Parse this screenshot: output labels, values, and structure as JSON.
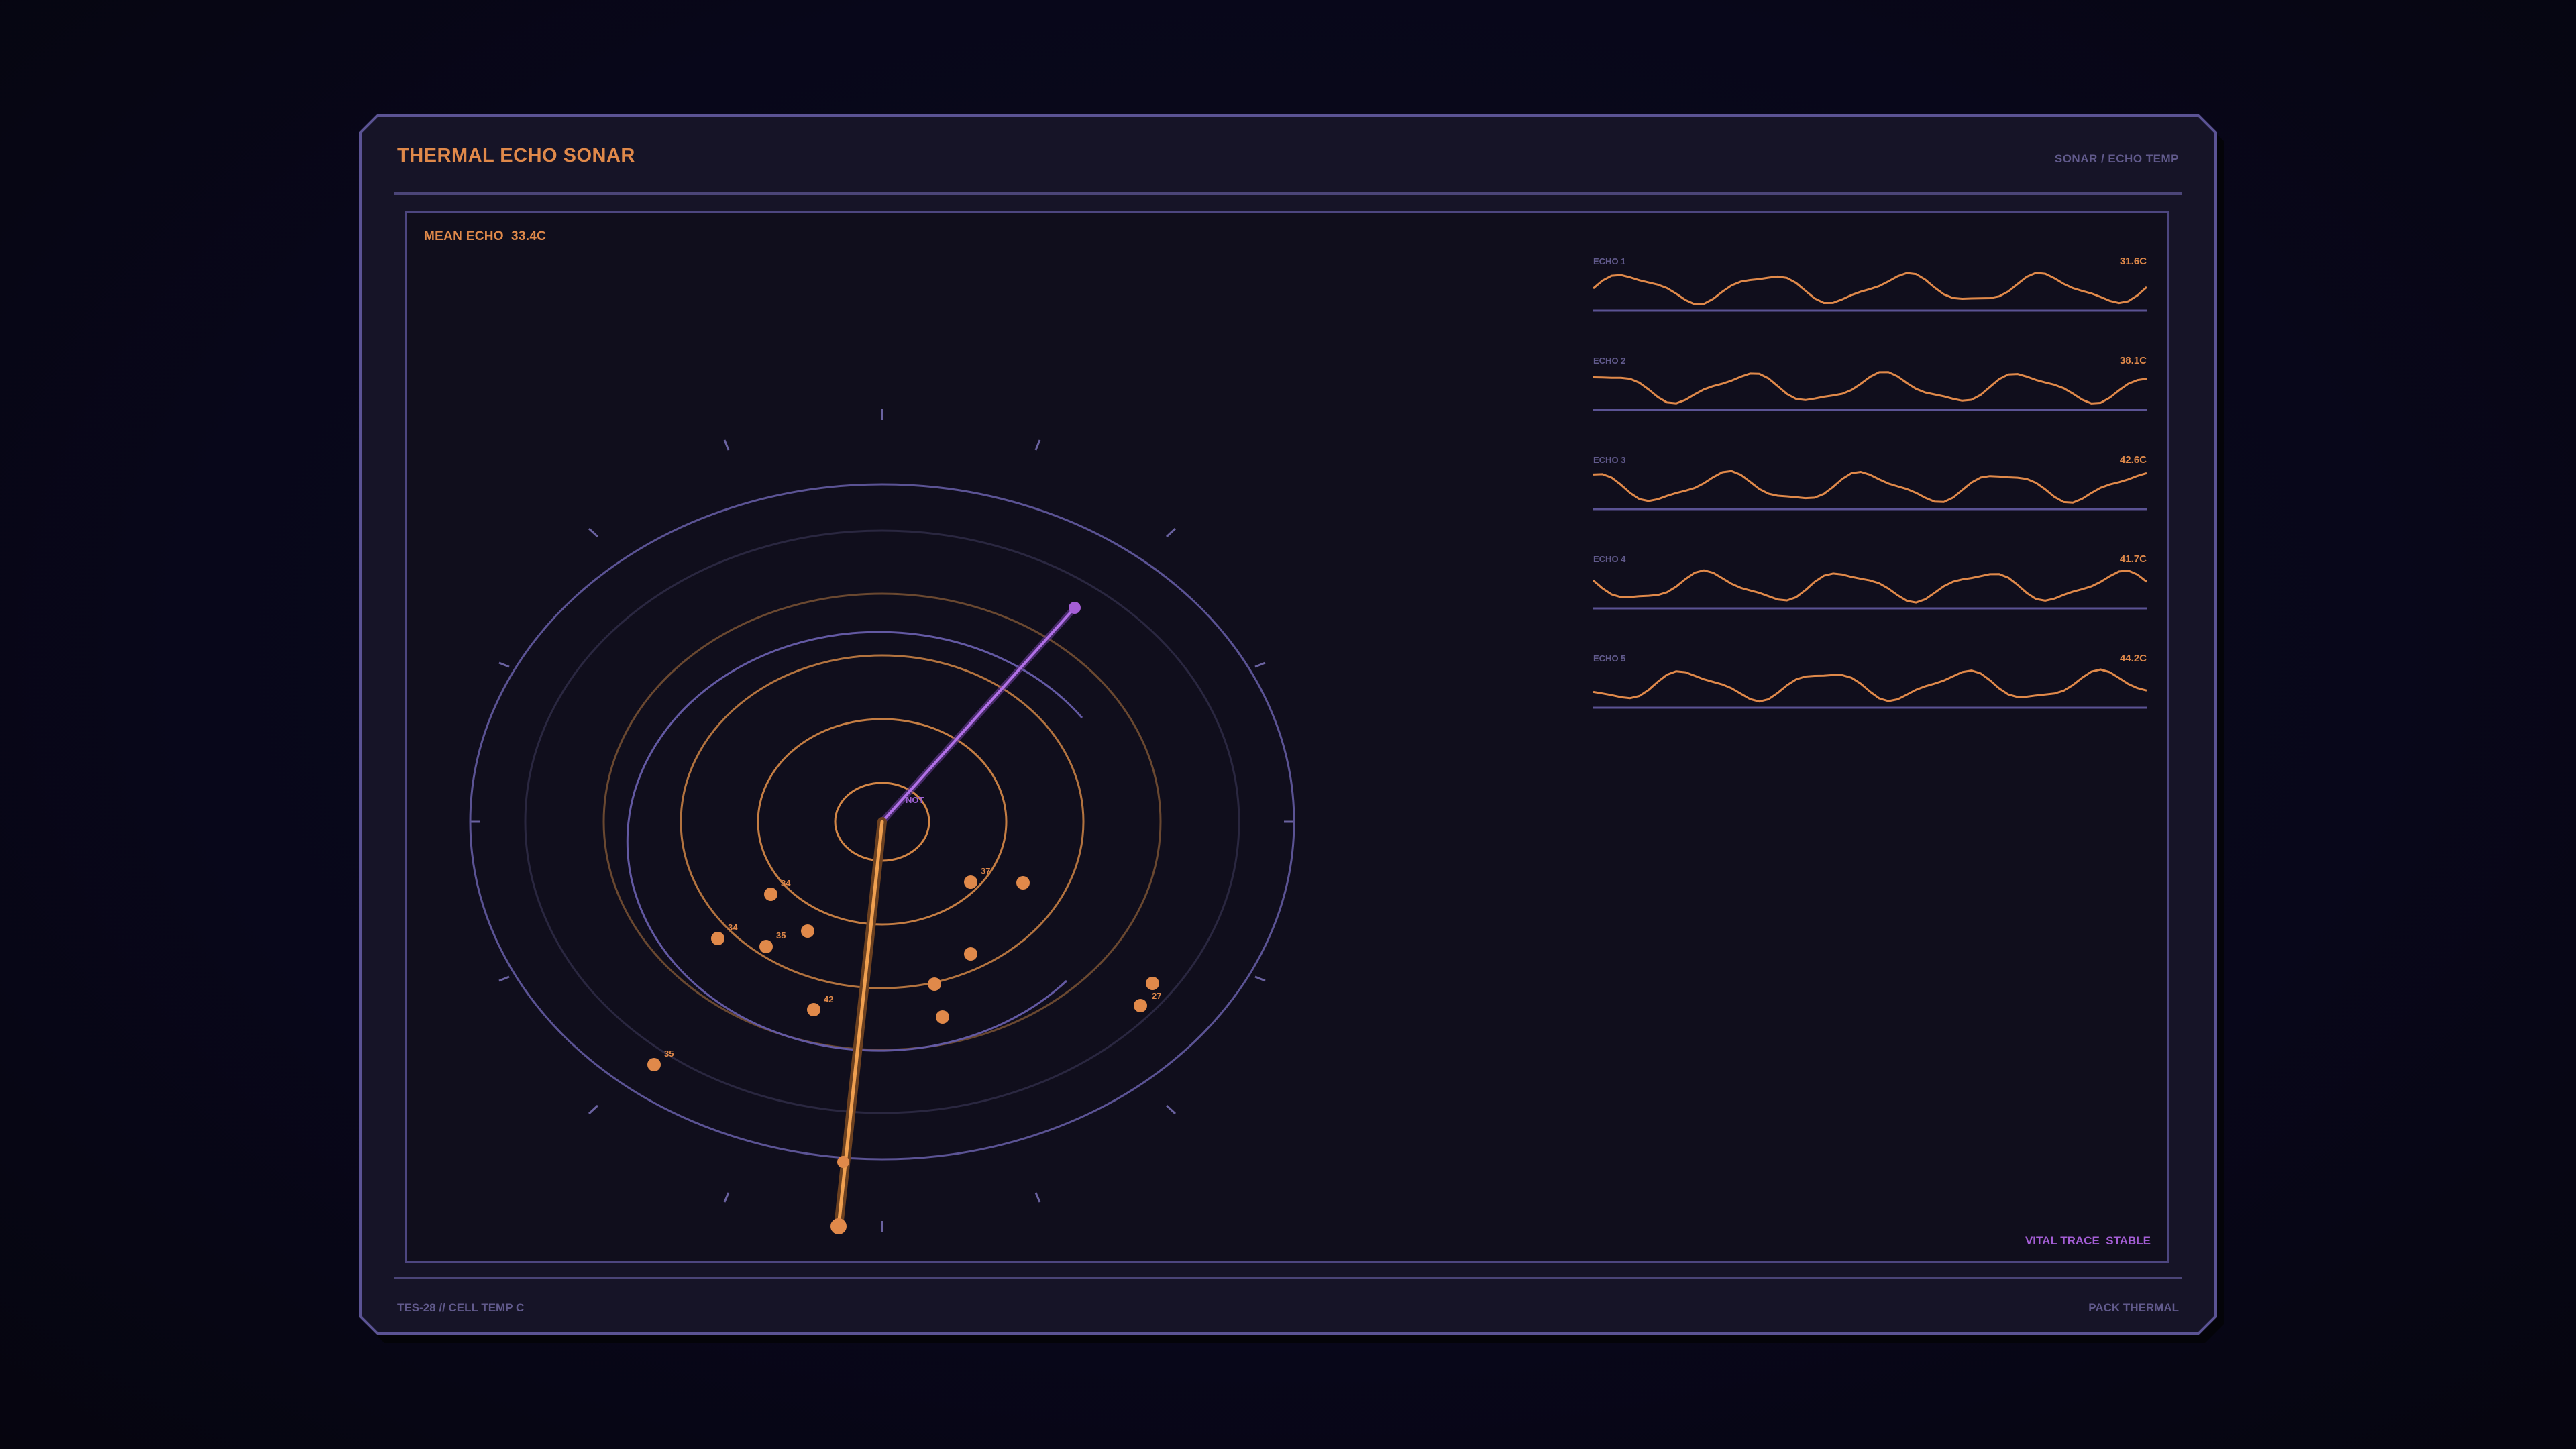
{
  "window": {
    "title": "THERMAL ECHO SONAR",
    "breadcrumb": "SONAR / ECHO TEMP"
  },
  "main": {
    "mean_label": "MEAN ECHO",
    "mean_value": "33.4C",
    "status_label": "VITAL TRACE",
    "status_value": "STABLE"
  },
  "footer": {
    "left": "TES-28 // CELL TEMP C",
    "right": "PACK THERMAL"
  },
  "radar": {
    "center_label": "NOT",
    "blips": [
      {
        "label": "34"
      },
      {
        "label": "34"
      },
      {
        "label": "35"
      },
      {
        "label": "42"
      },
      {
        "label": "37"
      },
      {
        "label": "27"
      },
      {
        "label": "35"
      }
    ]
  },
  "sparklines": [
    {
      "name": "ECHO 1",
      "value": "31.6C"
    },
    {
      "name": "ECHO 2",
      "value": "38.1C"
    },
    {
      "name": "ECHO 3",
      "value": "42.6C"
    },
    {
      "name": "ECHO 4",
      "value": "41.7C"
    },
    {
      "name": "ECHO 5",
      "value": "44.2C"
    }
  ],
  "colors": {
    "accent": "#e0894a",
    "violet": "#a55ed6",
    "frame": "#4d4680",
    "muted": "#615a8c"
  }
}
